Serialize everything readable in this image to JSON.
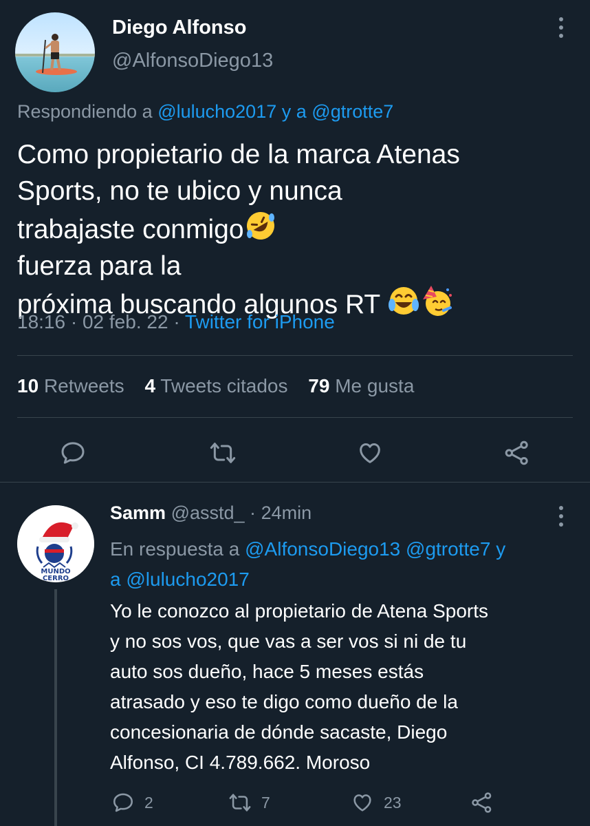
{
  "tweet": {
    "author_name": "Diego Alfonso",
    "author_handle": "@AlfonsoDiego13",
    "replying_prefix": "Respondiendo a",
    "replying_user1": "@lulucho2017",
    "replying_joiner": "y a",
    "replying_user2": "@gtrotte7",
    "text_lines": [
      "Como propietario de la marca Atenas",
      "Sports, no te ubico y nunca",
      "trabajaste conmigo",
      " fuerza para la",
      "próxima buscando algunos RT "
    ],
    "time": "18:16",
    "date": "02 feb. 22",
    "separator": "·",
    "source": "Twitter for iPhone",
    "stats": {
      "retweets_count": "10",
      "retweets_label": "Retweets",
      "quotes_count": "4",
      "quotes_label": "Tweets citados",
      "likes_count": "79",
      "likes_label": "Me gusta"
    },
    "emoji_icons": [
      "rolling-on-floor-laughing-icon",
      "tears-of-joy-icon",
      "partying-face-icon"
    ]
  },
  "reply": {
    "author_name": "Samm",
    "author_handle": "@asstd_",
    "separator": "·",
    "time_ago": "24min",
    "in_reply_prefix": "En respuesta a",
    "in_reply_user1": "@AlfonsoDiego13",
    "in_reply_user2": "@gtrotte7",
    "in_reply_joiner1": "y",
    "in_reply_joiner2": "a",
    "in_reply_user3": "@lulucho2017",
    "avatar_text": "MUNDO CERRO",
    "text_lines": [
      "Yo le conozco al propietario de Atena Sports",
      "y no sos vos, que vas a ser vos si ni de tu",
      "auto sos dueño, hace 5 meses estás",
      "atrasado y eso te digo como dueño de la",
      "concesionaria de dónde sacaste, Diego",
      "Alfonso, CI 4.789.662. Moroso"
    ],
    "replies_count": "2",
    "retweets_count": "7",
    "likes_count": "23"
  },
  "colors": {
    "background": "#15202b",
    "text": "#ffffff",
    "secondary": "#8b98a5",
    "link": "#1d9bf0",
    "divider": "#38444d"
  }
}
